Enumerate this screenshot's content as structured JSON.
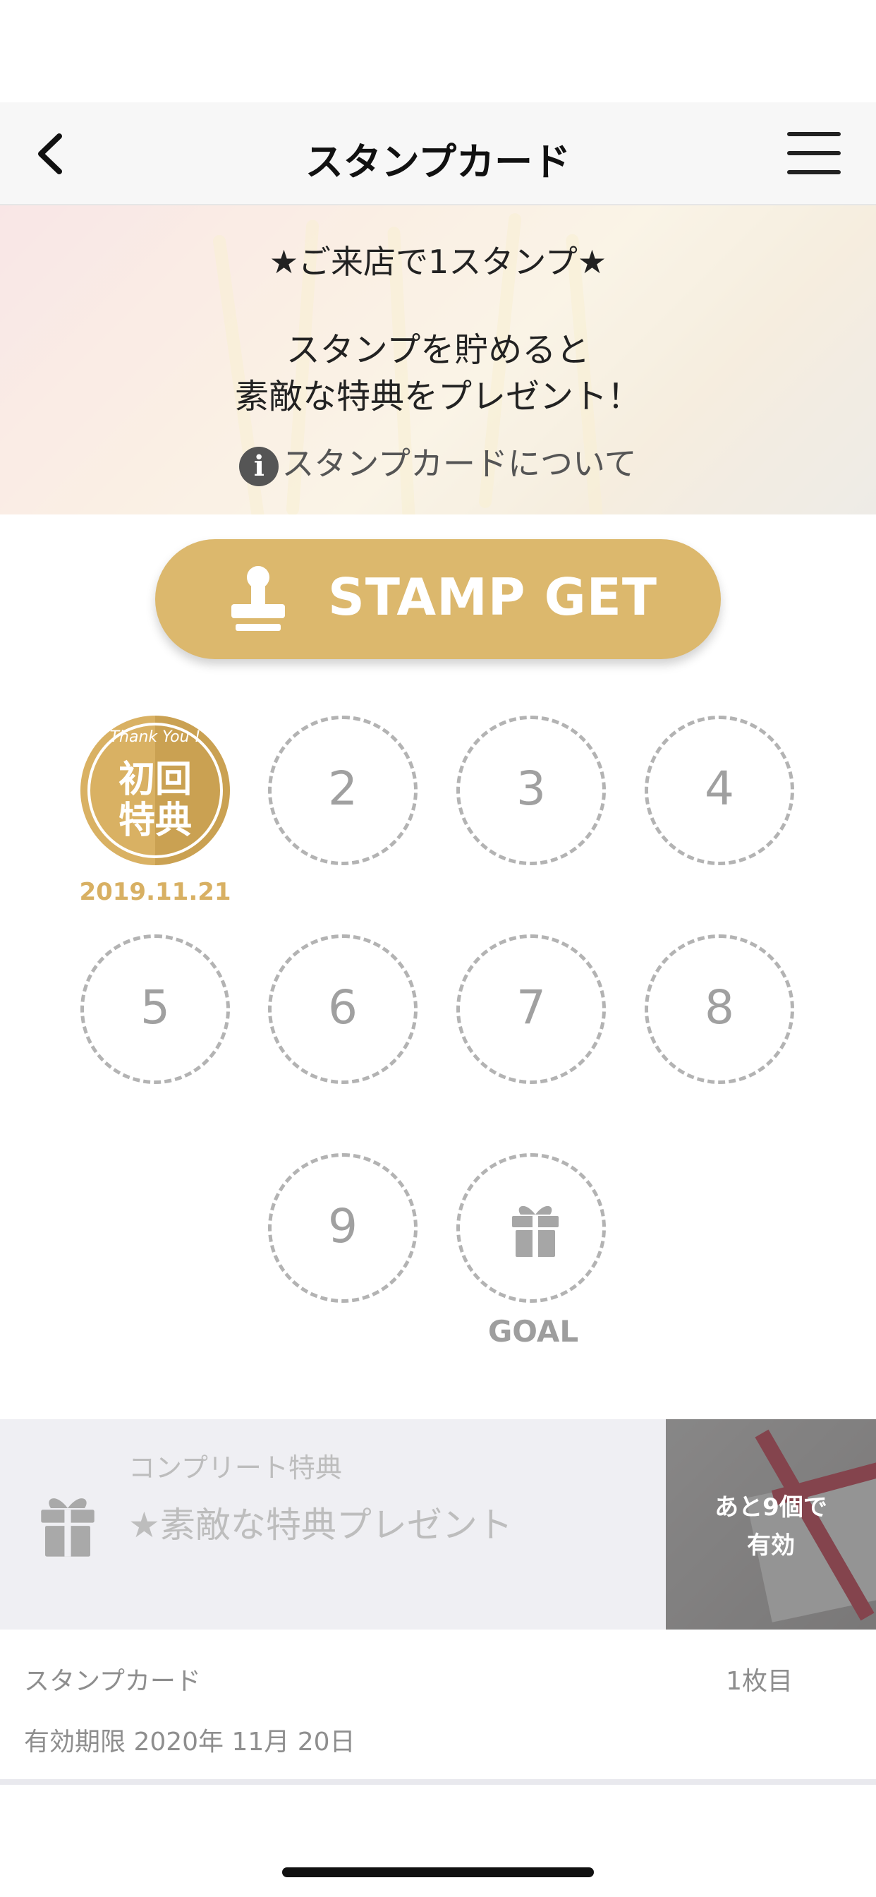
{
  "nav": {
    "title": "スタンプカード",
    "back_icon": "chevron-left-icon",
    "menu_icon": "hamburger-menu-icon"
  },
  "hero": {
    "line1": "★ご来店で1スタンプ★",
    "line2a": "スタンプを貯めると",
    "line2b": "素敵な特典をプレゼント！",
    "about_label": "スタンプカードについて",
    "about_icon": "info-icon"
  },
  "stamp_button": {
    "label": "STAMP GET",
    "icon": "stamp-icon",
    "color": "#dcb86d"
  },
  "stamps": {
    "first": {
      "caption": "Thank You !",
      "line1": "初回",
      "line2": "特典",
      "date": "2019.11.21",
      "color": "#d9b163"
    },
    "slots": [
      "2",
      "3",
      "4",
      "5",
      "6",
      "7",
      "8",
      "9"
    ],
    "goal_label": "GOAL",
    "goal_icon": "gift-icon"
  },
  "reward": {
    "subtitle": "コンプリート特典",
    "name": "★素敵な特典プレゼント",
    "icon": "gift-icon",
    "remaining_line1": "あと9個で",
    "remaining_line2": "有効"
  },
  "card_info": {
    "label": "スタンプカード",
    "count": "1枚目",
    "expiry": "有効期限 2020年 11月 20日"
  }
}
